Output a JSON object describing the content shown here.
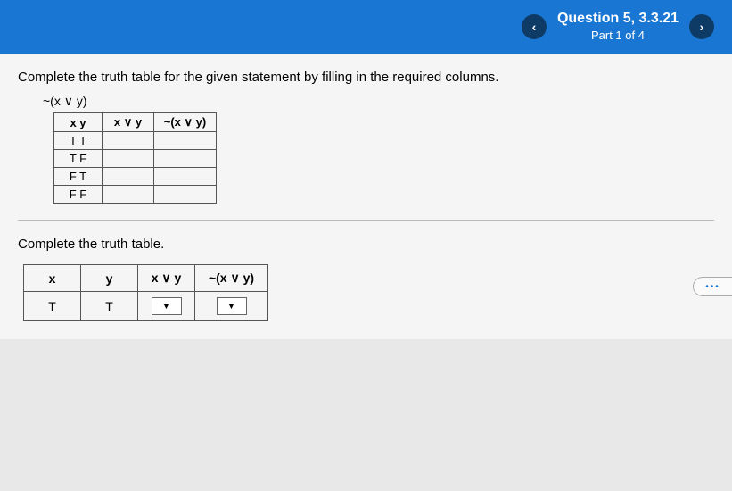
{
  "header": {
    "prev_icon": "‹",
    "next_icon": "›",
    "question_title": "Question 5, 3.3.21",
    "part": "Part 1 of 4"
  },
  "instruction": "Complete the truth table for the given statement by filling in the required columns.",
  "expression": "~(x ∨ y)",
  "ref_table": {
    "headers": {
      "xy": "x  y",
      "or": "x ∨ y",
      "neg": "~(x ∨ y)"
    },
    "rows": [
      {
        "xy": "T  T",
        "or": "",
        "neg": ""
      },
      {
        "xy": "T  F",
        "or": "",
        "neg": ""
      },
      {
        "xy": "F  T",
        "or": "",
        "neg": ""
      },
      {
        "xy": "F  F",
        "or": "",
        "neg": ""
      }
    ]
  },
  "sub_instruction": "Complete the truth table.",
  "ans_table": {
    "headers": {
      "x": "x",
      "y": "y",
      "or": "x ∨ y",
      "neg": "~(x ∨ y)"
    },
    "row": {
      "x": "T",
      "y": "T"
    }
  },
  "more": "•••"
}
